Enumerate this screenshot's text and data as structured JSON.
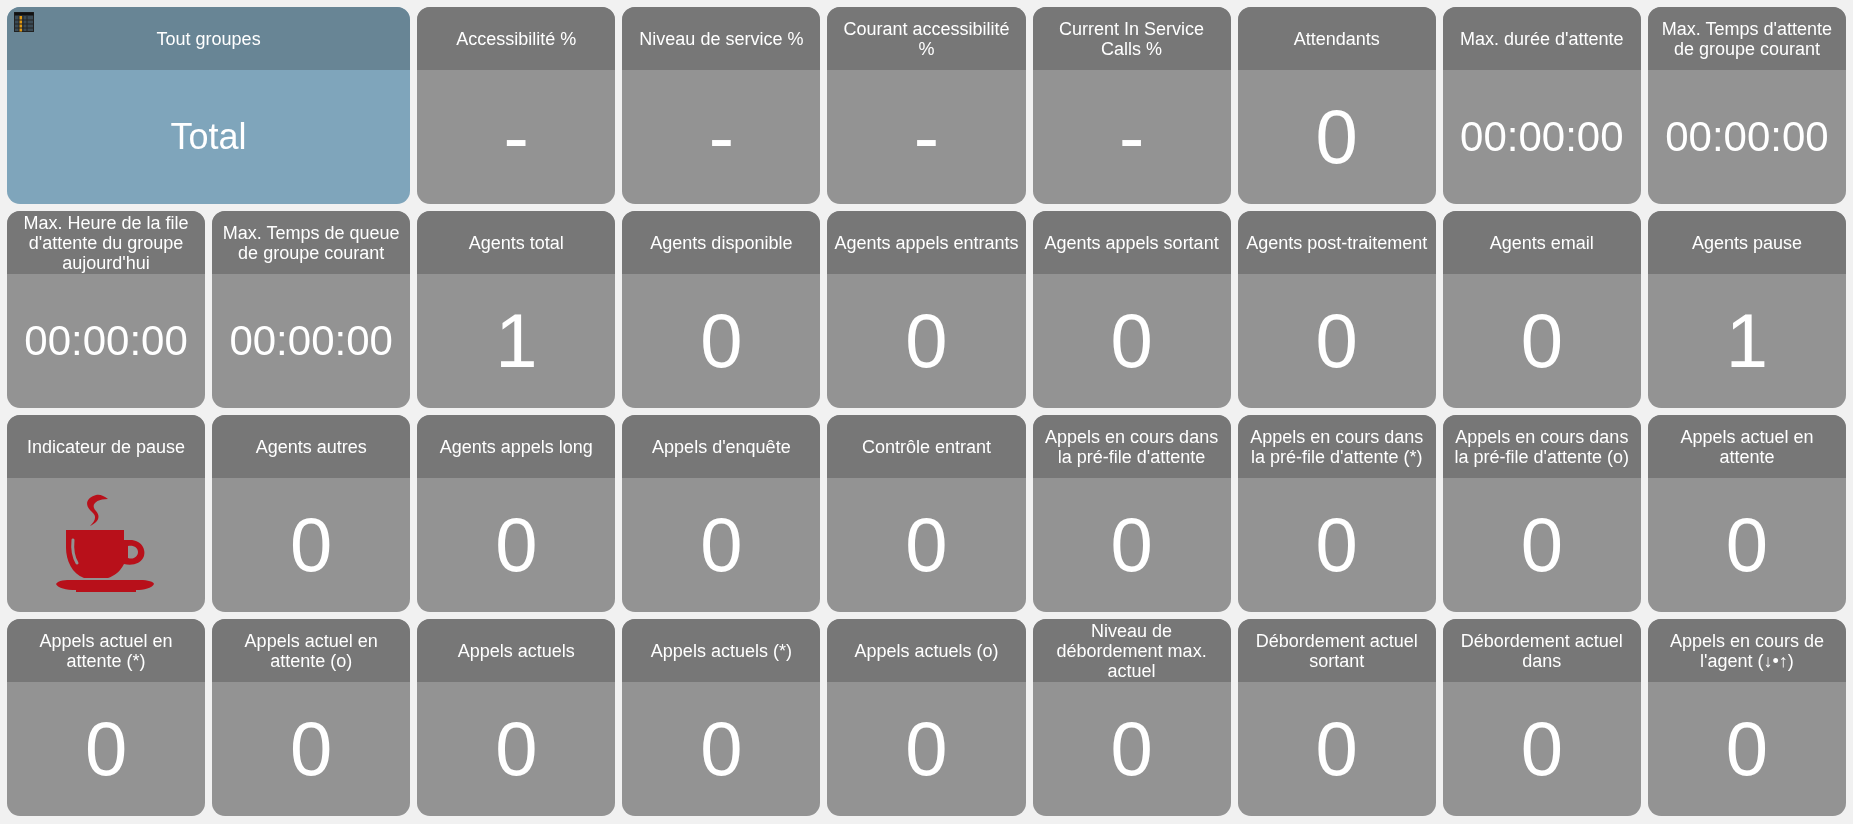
{
  "tiles": [
    {
      "kind": "group",
      "label": "Tout groupes",
      "value": "Total"
    },
    {
      "kind": "number",
      "label": "Accessibilité %",
      "value": "-"
    },
    {
      "kind": "number",
      "label": "Niveau de service %",
      "value": "-"
    },
    {
      "kind": "number",
      "label": "Courant accessibilité %",
      "value": "-"
    },
    {
      "kind": "number",
      "label": "Current In Service Calls %",
      "value": "-"
    },
    {
      "kind": "number",
      "label": "Attendants",
      "value": "0"
    },
    {
      "kind": "time",
      "label": "Max. durée d'attente",
      "value": "00:00:00"
    },
    {
      "kind": "time",
      "label": "Max. Temps d'attente de groupe courant",
      "value": "00:00:00"
    },
    {
      "kind": "time",
      "label": "Max. Heure de la file d'attente du groupe aujourd'hui",
      "value": "00:00:00"
    },
    {
      "kind": "time",
      "label": "Max. Temps de queue de groupe courant",
      "value": "00:00:00"
    },
    {
      "kind": "number",
      "label": "Agents total",
      "value": "1"
    },
    {
      "kind": "number",
      "label": "Agents disponible",
      "value": "0"
    },
    {
      "kind": "number",
      "label": "Agents appels entrants",
      "value": "0"
    },
    {
      "kind": "number",
      "label": "Agents appels sortant",
      "value": "0"
    },
    {
      "kind": "number",
      "label": "Agents post-traitement",
      "value": "0"
    },
    {
      "kind": "number",
      "label": "Agents email",
      "value": "0"
    },
    {
      "kind": "number",
      "label": "Agents pause",
      "value": "1"
    },
    {
      "kind": "pause",
      "label": "Indicateur de pause"
    },
    {
      "kind": "number",
      "label": "Agents autres",
      "value": "0"
    },
    {
      "kind": "number",
      "label": "Agents appels long",
      "value": "0"
    },
    {
      "kind": "number",
      "label": "Appels d'enquête",
      "value": "0"
    },
    {
      "kind": "number",
      "label": "Contrôle entrant",
      "value": "0"
    },
    {
      "kind": "number",
      "label": "Appels en cours dans la pré-file d'attente",
      "value": "0"
    },
    {
      "kind": "number",
      "label": "Appels en cours dans la pré-file d'attente (*)",
      "value": "0"
    },
    {
      "kind": "number",
      "label": "Appels en cours dans la pré-file d'attente (o)",
      "value": "0"
    },
    {
      "kind": "number",
      "label": "Appels actuel en attente",
      "value": "0"
    },
    {
      "kind": "number",
      "label": "Appels actuel en attente (*)",
      "value": "0"
    },
    {
      "kind": "number",
      "label": "Appels actuel en attente (o)",
      "value": "0"
    },
    {
      "kind": "number",
      "label": "Appels actuels",
      "value": "0"
    },
    {
      "kind": "number",
      "label": "Appels actuels (*)",
      "value": "0"
    },
    {
      "kind": "number",
      "label": "Appels actuels (o)",
      "value": "0"
    },
    {
      "kind": "number",
      "label": "Niveau de débordement max. actuel",
      "value": "0"
    },
    {
      "kind": "number",
      "label": "Débordement actuel sortant",
      "value": "0"
    },
    {
      "kind": "number",
      "label": "Débordement actuel dans",
      "value": "0"
    },
    {
      "kind": "number",
      "label": "Appels en cours de l'agent (↓•↑)",
      "value": "0"
    }
  ]
}
